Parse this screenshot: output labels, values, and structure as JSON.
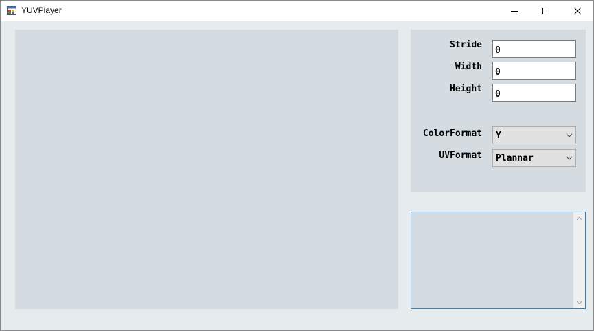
{
  "window": {
    "title": "YUVPlayer",
    "app_icon": "app-window-icon",
    "controls": {
      "minimize_icon": "minimize-icon",
      "maximize_icon": "maximize-icon",
      "close_icon": "close-icon"
    }
  },
  "settings": {
    "stride_label": "Stride",
    "stride_value": "0",
    "width_label": "Width",
    "width_value": "0",
    "height_label": "Height",
    "height_value": "0",
    "color_format_label": "ColorFormat",
    "color_format_value": "Y",
    "uv_format_label": "UVFormat",
    "uv_format_value": "Plannar"
  },
  "log": {
    "text": ""
  },
  "colors": {
    "client_bg": "#e6ebee",
    "panel_bg": "#d4dce1",
    "log_border": "#3c7fb1"
  }
}
